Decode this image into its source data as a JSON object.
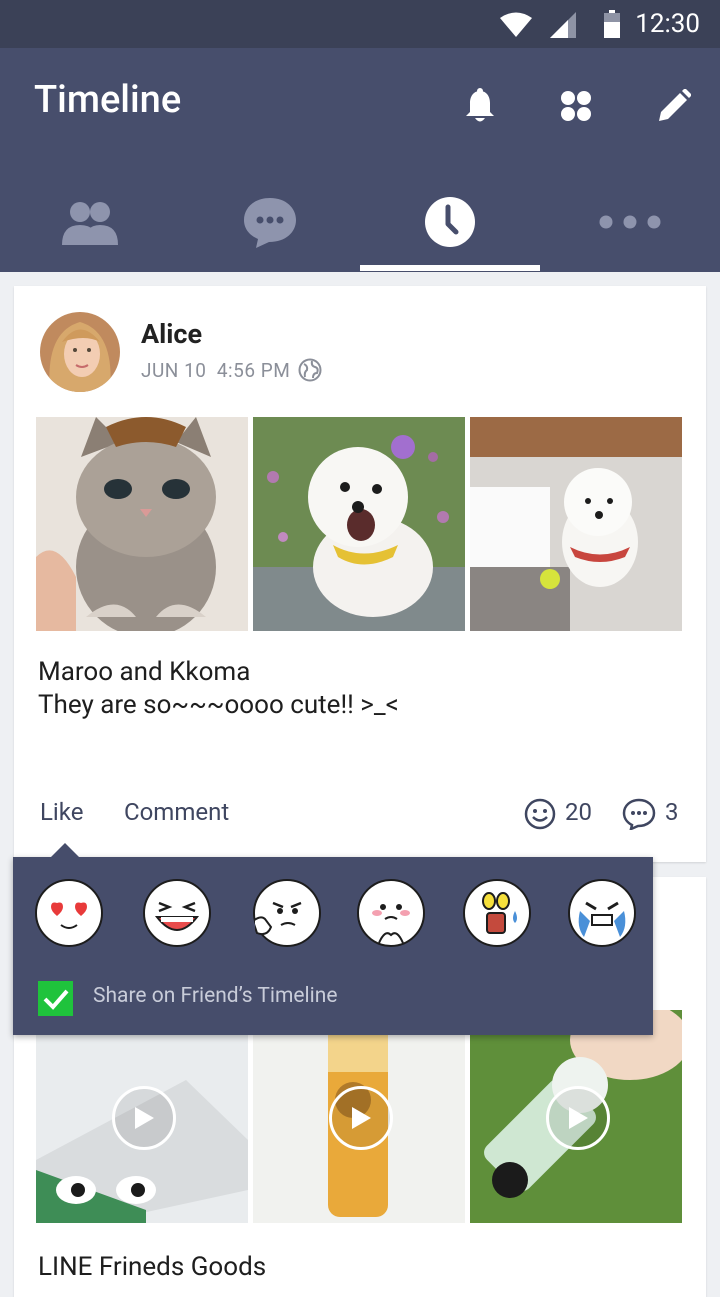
{
  "status_bar": {
    "time": "12:30"
  },
  "app_bar": {
    "title": "Timeline",
    "actions": [
      "bell-icon",
      "apps-icon",
      "edit-icon"
    ],
    "tabs": [
      "friends",
      "chats",
      "timeline",
      "more"
    ],
    "active_tab": "timeline"
  },
  "post1": {
    "author": "Alice",
    "date": "JUN 10",
    "time": "4:56 PM",
    "text_line1": "Maroo and Kkoma",
    "text_line2": "They are so~~~oooo cute!! >_<",
    "like_label": "Like",
    "comment_label": "Comment",
    "reactions_count": "20",
    "comments_count": "3"
  },
  "reaction_popup": {
    "stickers": [
      "heart-eyes-sticker",
      "laughing-sticker",
      "thumbs-up-sticker",
      "shy-sticker",
      "shocked-sticker",
      "crying-sticker"
    ],
    "share_label": "Share on Friend’s Timeline",
    "share_checked": true
  },
  "post2": {
    "title": "LINE Frineds Goods"
  },
  "colors": {
    "appbar": "#474e6c",
    "statusbar": "#3b4157",
    "accent_green": "#1fc33c"
  }
}
